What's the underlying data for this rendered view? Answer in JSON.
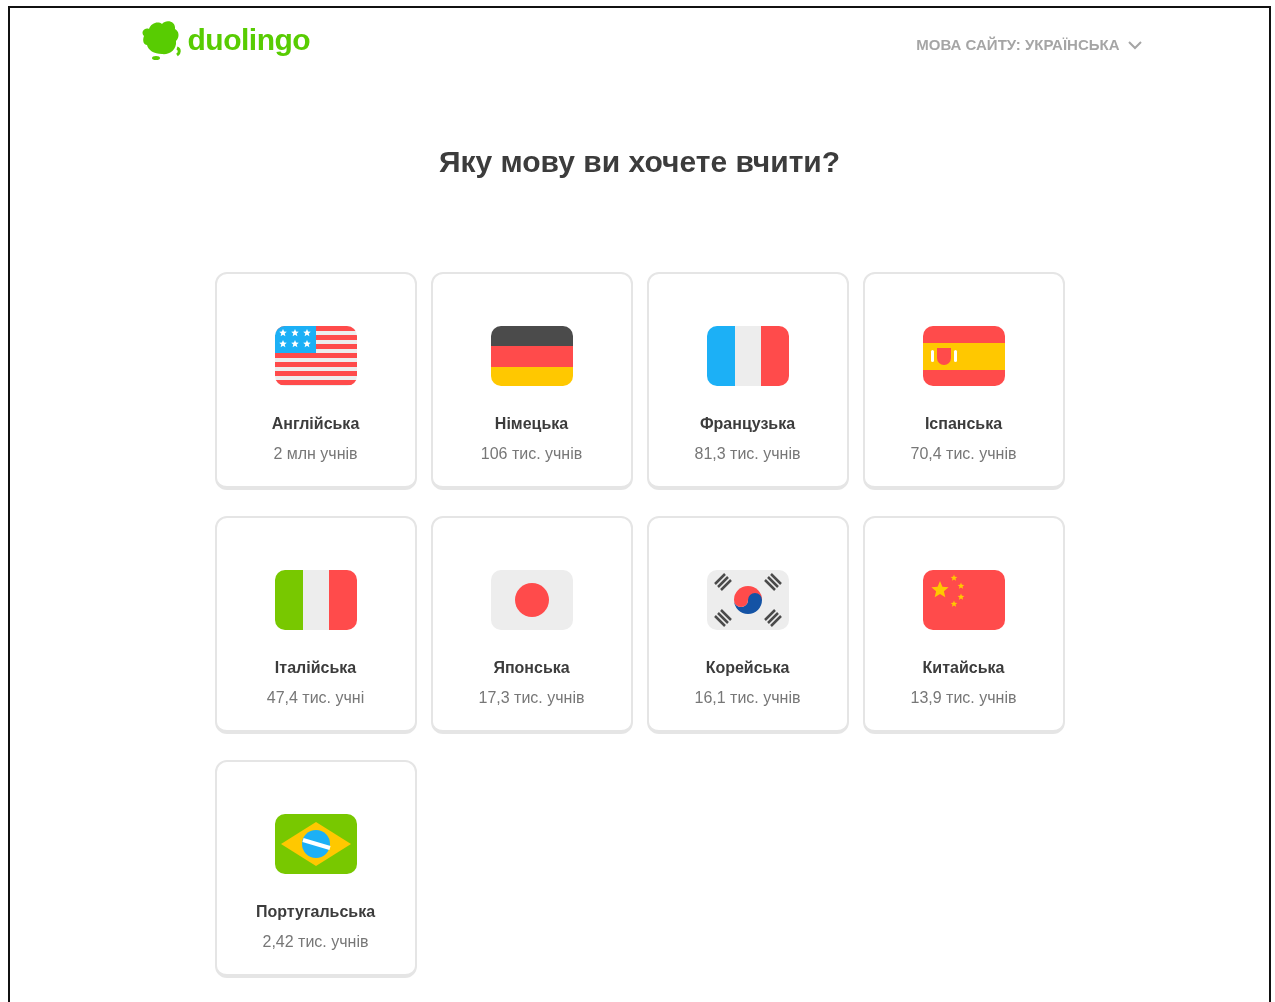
{
  "header": {
    "logo": "duolingo",
    "language_menu": "МОВА САЙТУ: УКРАЇНСЬКА"
  },
  "title": "Яку мову ви хочете вчити?",
  "courses": [
    {
      "kind": "us",
      "name": "Англійська",
      "learners": "2 млн учнів"
    },
    {
      "kind": "de",
      "name": "Німецька",
      "learners": "106 тис. учнів"
    },
    {
      "kind": "fr",
      "name": "Французька",
      "learners": "81,3 тис. учнів"
    },
    {
      "kind": "es",
      "name": "Іспанська",
      "learners": "70,4 тис. учнів"
    },
    {
      "kind": "it",
      "name": "Італійська",
      "learners": "47,4 тис. учні"
    },
    {
      "kind": "jp",
      "name": "Японська",
      "learners": "17,3 тис. учнів"
    },
    {
      "kind": "kr",
      "name": "Корейська",
      "learners": "16,1 тис. учнів"
    },
    {
      "kind": "cn",
      "name": "Китайська",
      "learners": "13,9 тис. учнів"
    },
    {
      "kind": "br",
      "name": "Португальська",
      "learners": "2,42 тис. учнів"
    }
  ]
}
